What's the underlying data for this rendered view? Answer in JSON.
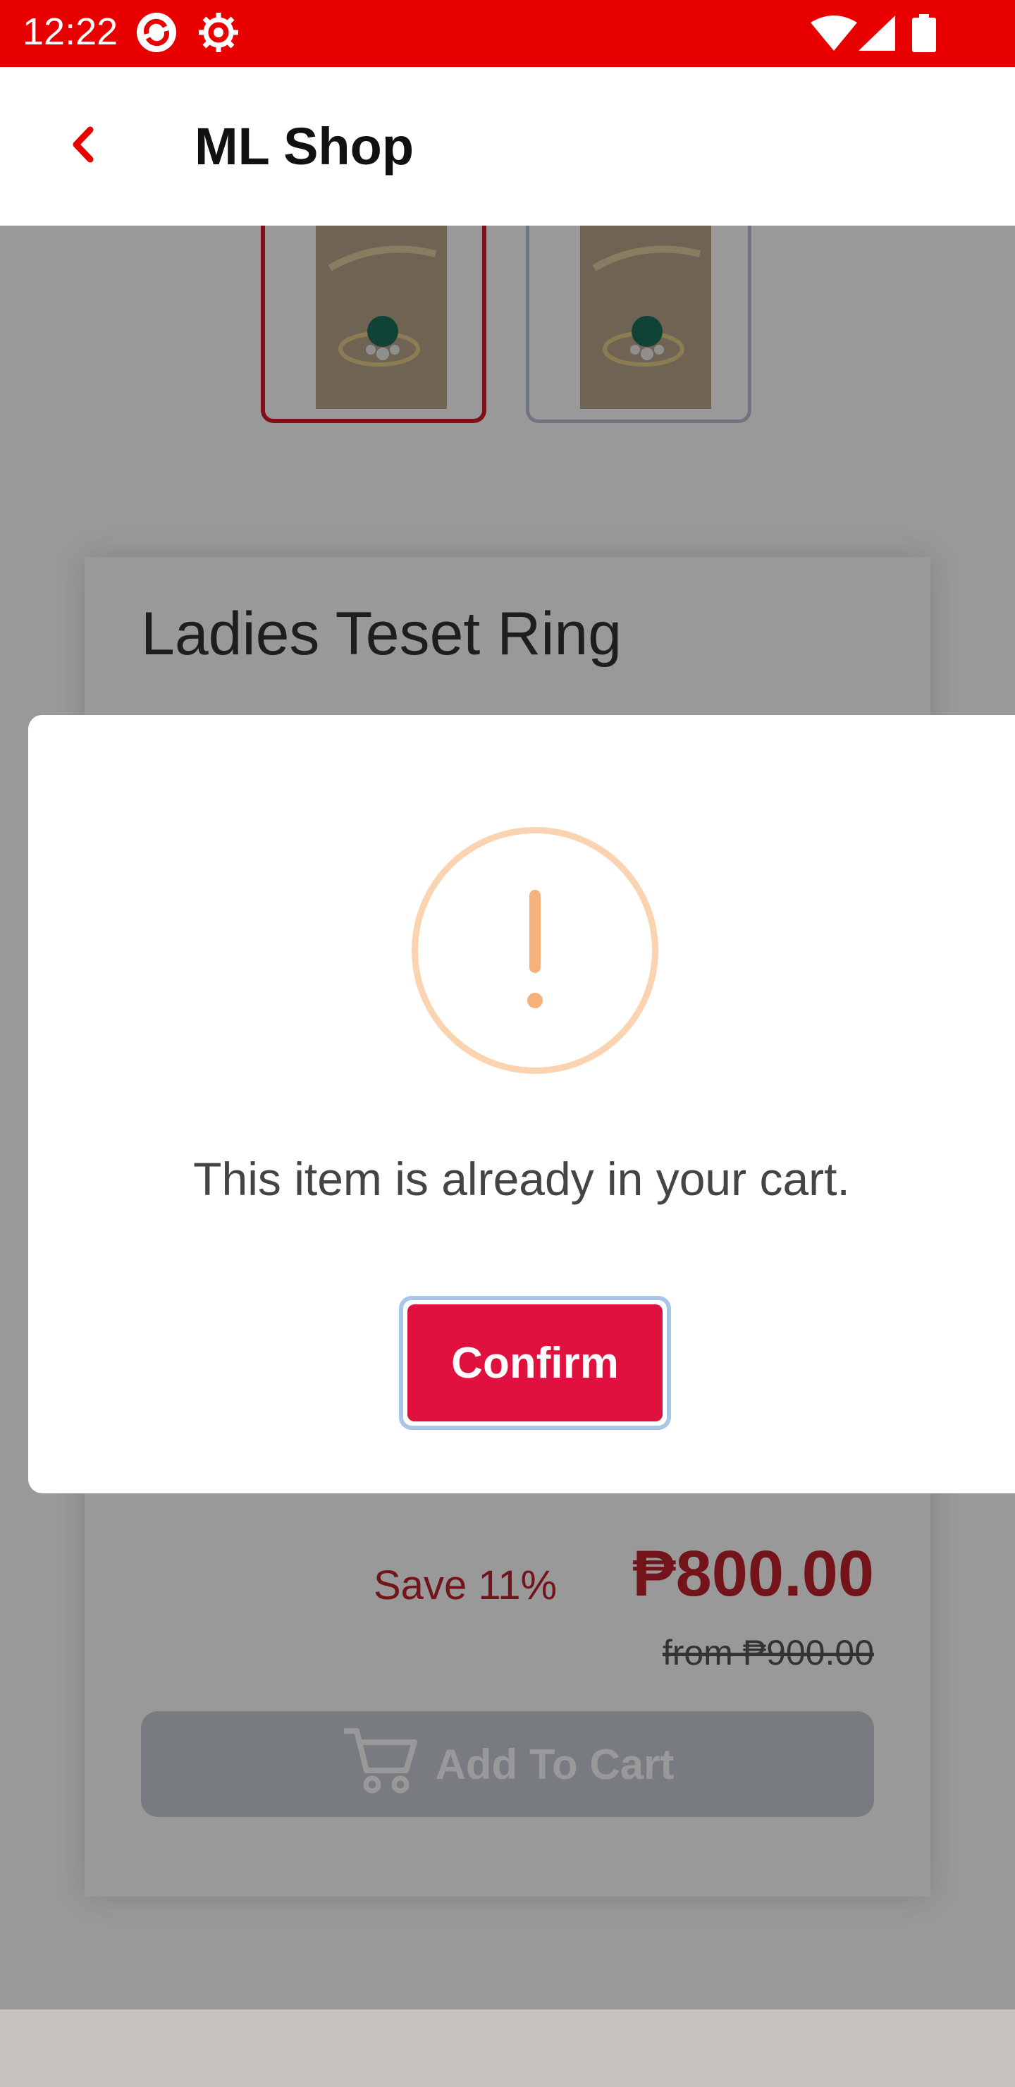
{
  "status_bar": {
    "time": "12:22"
  },
  "app_bar": {
    "title": "ML Shop"
  },
  "product": {
    "title": "Ladies Teset Ring",
    "save_text": "Save 11%",
    "price": "₱800.00",
    "original_price": "from ₱900.00",
    "add_to_cart_label": "Add To Cart"
  },
  "dialog": {
    "message": "This item is already in your cart.",
    "confirm_label": "Confirm"
  },
  "colors": {
    "status_bar": "#e80000",
    "accent_red": "#c0222e",
    "confirm_button": "#e0103f",
    "alert_orange": "#f5b27a"
  }
}
